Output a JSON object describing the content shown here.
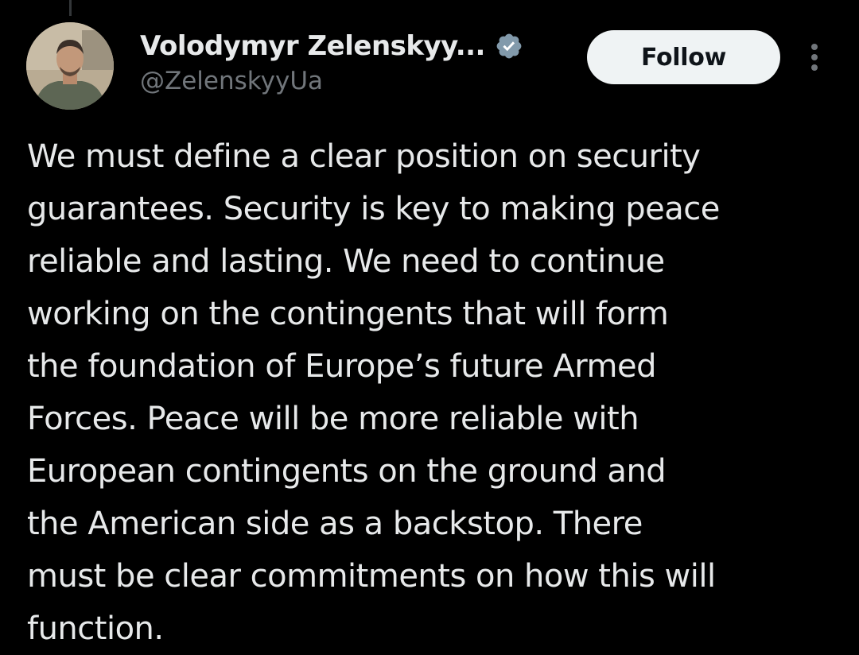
{
  "tweet": {
    "author": {
      "display_name": "Volodymyr Zelenskyy...",
      "handle": "@ZelenskyyUa",
      "verified": true,
      "avatar_icon": "profile-photo"
    },
    "follow_label": "Follow",
    "more_icon": "more-vertical-icon",
    "text": "We must define a clear position on security\nguarantees. Security is key to making peace\nreliable and lasting. We need to continue\nworking on the contingents that will form\nthe foundation of Europe’s future Armed\nForces. Peace will be more reliable with\nEuropean contingents on the ground and\nthe American side as a backstop. There\nmust be clear commitments on how this will\nfunction."
  },
  "colors": {
    "background": "#000000",
    "text_primary": "#e7e9ea",
    "text_secondary": "#71767b",
    "follow_button_bg": "#eff3f4",
    "follow_button_text": "#0f1419",
    "verified_badge": "#829aab"
  }
}
